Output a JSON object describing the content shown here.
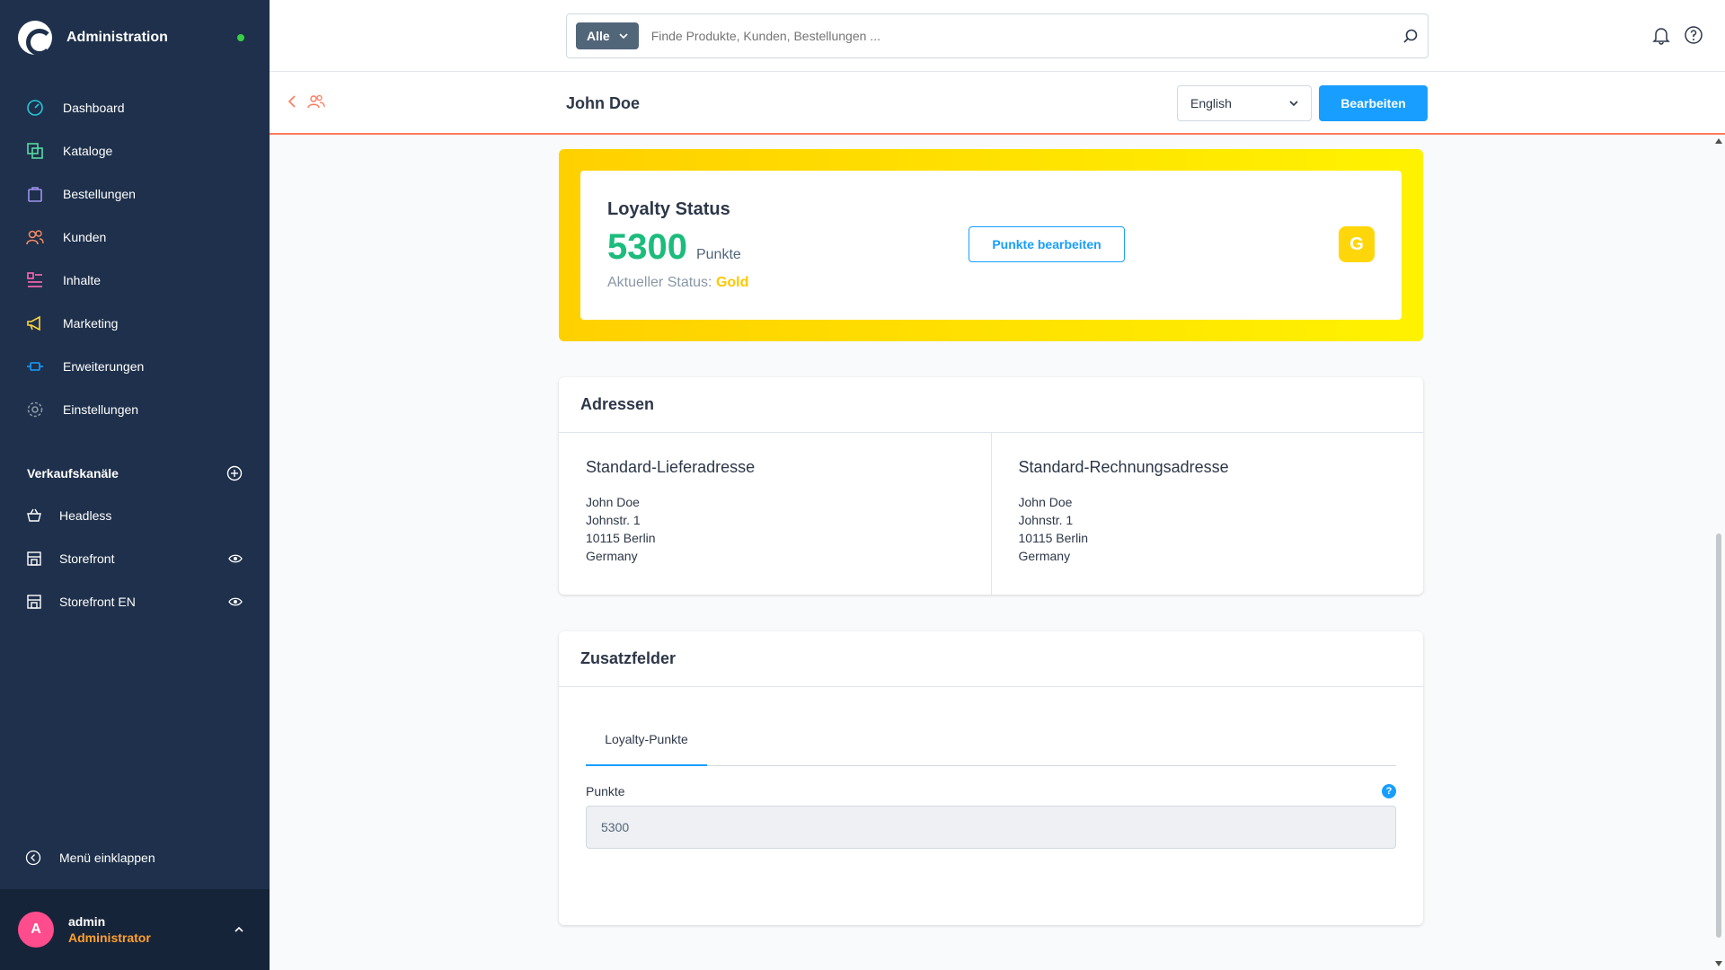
{
  "sidebar": {
    "title": "Administration",
    "nav": [
      {
        "label": "Dashboard",
        "icon": "dashboard-icon",
        "color": "#26c6da"
      },
      {
        "label": "Kataloge",
        "icon": "catalog-icon",
        "color": "#57d9a3"
      },
      {
        "label": "Bestellungen",
        "icon": "bag-icon",
        "color": "#a092f0"
      },
      {
        "label": "Kunden",
        "icon": "users-icon",
        "color": "#f88962"
      },
      {
        "label": "Inhalte",
        "icon": "content-icon",
        "color": "#ff68b4"
      },
      {
        "label": "Marketing",
        "icon": "megaphone-icon",
        "color": "#ffd53d"
      },
      {
        "label": "Erweiterungen",
        "icon": "plug-icon",
        "color": "#189eff"
      },
      {
        "label": "Einstellungen",
        "icon": "gear-icon",
        "color": "#8a97a5"
      }
    ],
    "channels_title": "Verkaufskanäle",
    "channels": [
      {
        "label": "Headless"
      },
      {
        "label": "Storefront"
      },
      {
        "label": "Storefront EN"
      }
    ],
    "collapse_label": "Menü einklappen",
    "user": {
      "initial": "A",
      "name": "admin",
      "role": "Administrator"
    }
  },
  "header": {
    "search_type": "Alle",
    "search_placeholder": "Finde Produkte, Kunden, Bestellungen ..."
  },
  "subheader": {
    "title": "John Doe",
    "language": "English",
    "edit_label": "Bearbeiten"
  },
  "loyalty": {
    "title": "Loyalty Status",
    "points": "5300",
    "points_unit": "Punkte",
    "status_label": "Aktueller Status:",
    "status_value": "Gold",
    "edit_points_label": "Punkte bearbeiten",
    "badge": "G"
  },
  "addresses": {
    "title": "Adressen",
    "shipping": {
      "title": "Standard-Lieferadresse",
      "lines": [
        "John Doe",
        "Johnstr. 1",
        "10115 Berlin",
        "Germany"
      ]
    },
    "billing": {
      "title": "Standard-Rechnungsadresse",
      "lines": [
        "John Doe",
        "Johnstr. 1",
        "10115 Berlin",
        "Germany"
      ]
    }
  },
  "custom_fields": {
    "title": "Zusatzfelder",
    "tab": "Loyalty-Punkte",
    "field_label": "Punkte",
    "field_value": "5300"
  }
}
